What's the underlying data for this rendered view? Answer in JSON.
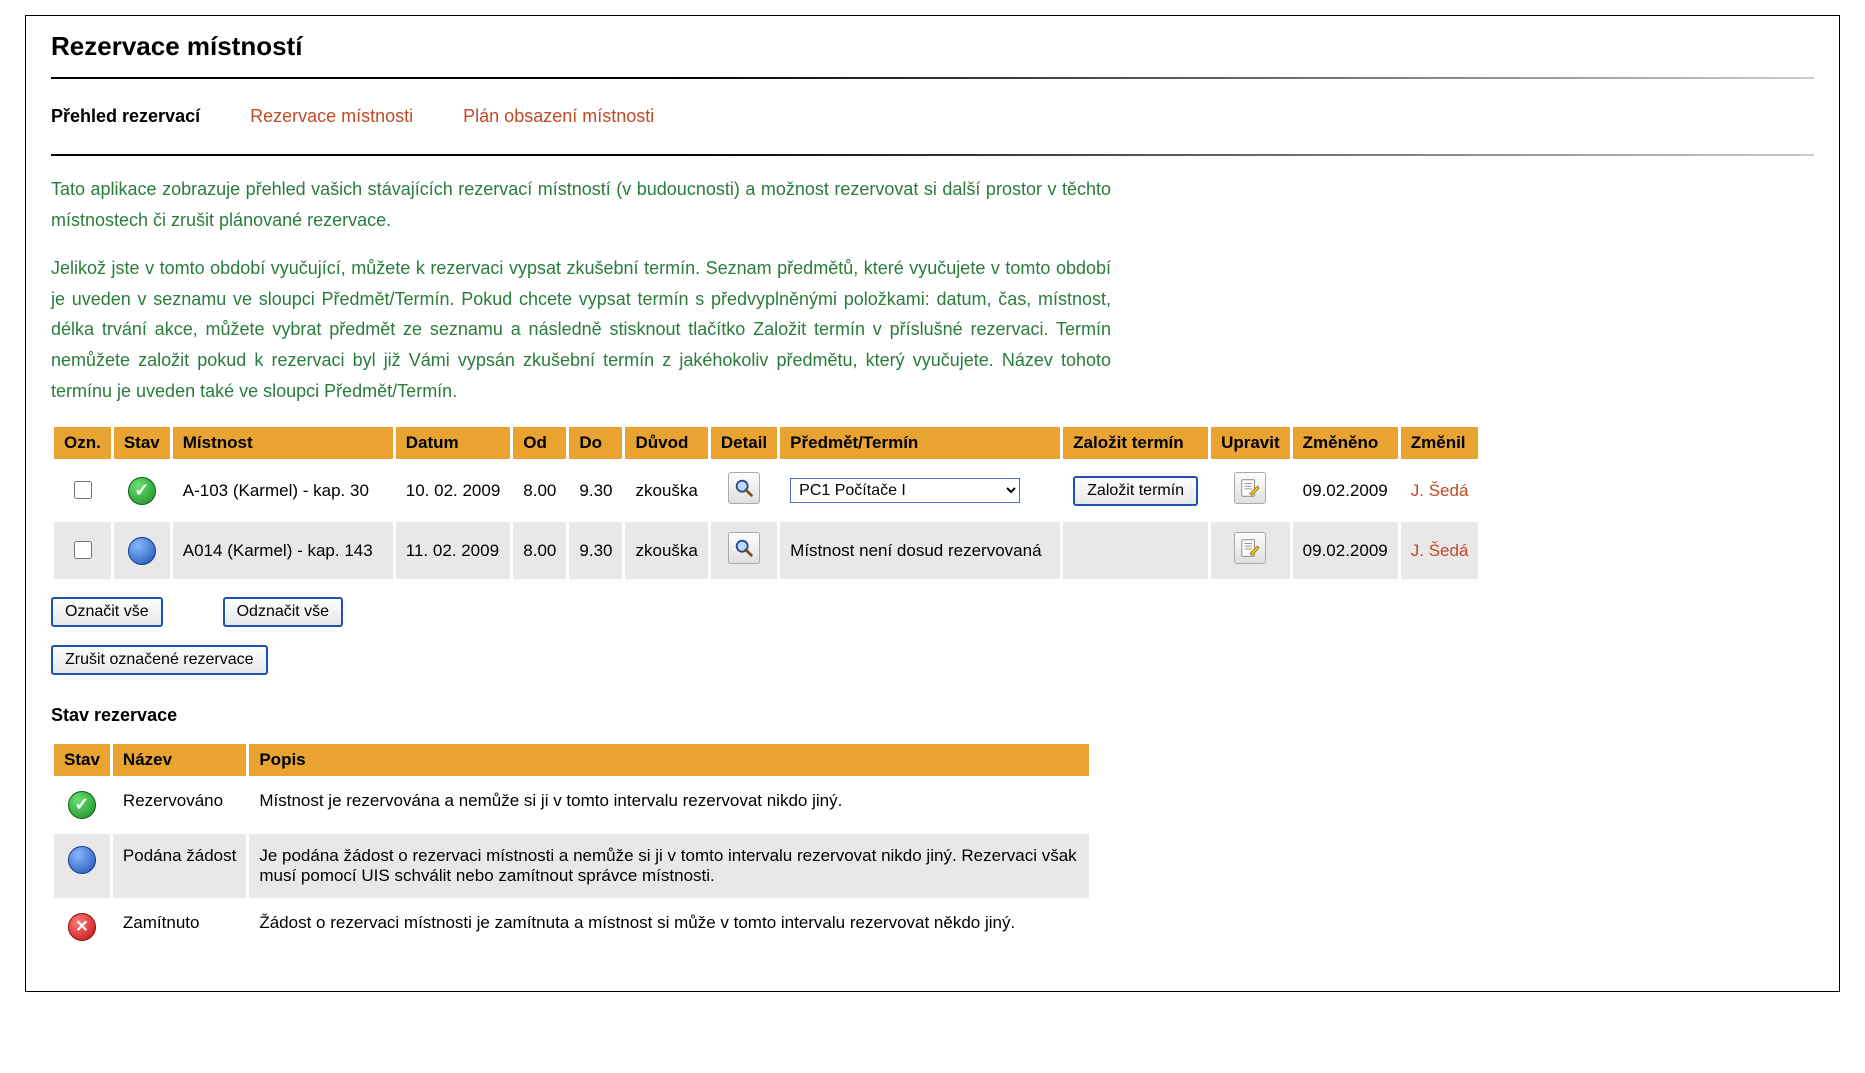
{
  "page": {
    "title": "Rezervace místností"
  },
  "tabs": {
    "overview": "Přehled rezervací",
    "reserve": "Rezervace místnosti",
    "plan": "Plán obsazení místnosti"
  },
  "intro": {
    "p1": "Tato aplikace zobrazuje přehled vašich stávajících rezervací místností (v budoucnosti) a možnost rezervovat si další prostor v těchto místnostech či zrušit plánované rezervace.",
    "p2": "Jelikož jste v tomto období vyučující, můžete k rezervaci vypsat zkušební termín. Seznam předmětů, které vyučujete v tomto období je uveden v seznamu ve sloupci Předmět/Termín. Pokud chcete vypsat termín s předvyplněnými položkami: datum, čas, místnost, délka trvání akce, můžete vybrat předmět ze seznamu a následně stisknout tlačítko Založit termín v příslušné rezervaci. Termín nemůžete založit pokud k rezervaci byl již Vámi vypsán zkušební termín z jakéhokoliv předmětu, který vyučujete. Název tohoto termínu je uveden také ve sloupci Předmět/Termín."
  },
  "table": {
    "headers": {
      "mark": "Ozn.",
      "status": "Stav",
      "room": "Místnost",
      "date": "Datum",
      "from": "Od",
      "to": "Do",
      "reason": "Důvod",
      "detail": "Detail",
      "subject": "Předmět/Termín",
      "create": "Založit termín",
      "edit": "Upravit",
      "changed_by": "Změnil",
      "changed": "Změněno"
    },
    "rows": [
      {
        "status": "reserved",
        "room": "A-103 (Karmel) - kap. 30",
        "date": "10. 02. 2009",
        "from": "8.00",
        "to": "9.30",
        "reason": "zkouška",
        "subject_select": "PC1 Počítače I",
        "subject_text": "",
        "show_select": true,
        "show_create": true,
        "create_btn": "Založit termín",
        "changed": "09.02.2009",
        "changed_by": "J. Šedá"
      },
      {
        "status": "pending",
        "room": "A014 (Karmel) - kap. 143",
        "date": "11. 02. 2009",
        "from": "8.00",
        "to": "9.30",
        "reason": "zkouška",
        "subject_text": "Místnost není dosud rezervovaná",
        "show_select": false,
        "show_create": false,
        "changed": "09.02.2009",
        "changed_by": "J. Šedá"
      }
    ]
  },
  "buttons": {
    "select_all": "Označit vše",
    "deselect_all": "Odznačit vše",
    "cancel_selected": "Zrušit označené rezervace"
  },
  "legend": {
    "title": "Stav rezervace",
    "headers": {
      "status": "Stav",
      "name": "Název",
      "desc": "Popis"
    },
    "rows": [
      {
        "status": "reserved",
        "name": "Rezervováno",
        "desc": "Místnost je rezervována a nemůže si ji v tomto intervalu rezervovat nikdo jiný."
      },
      {
        "status": "pending",
        "name": "Podána žádost",
        "desc": "Je podána žádost o rezervaci místnosti a nemůže si ji v tomto intervalu rezervovat nikdo jiný. Rezervaci však musí pomocí UIS schválit nebo zamítnout správce místnosti."
      },
      {
        "status": "rejected",
        "name": "Zamítnuto",
        "desc": "Žádost o rezervaci místnosti je zamítnuta a místnost si může v tomto intervalu rezervovat někdo jiný."
      }
    ]
  }
}
